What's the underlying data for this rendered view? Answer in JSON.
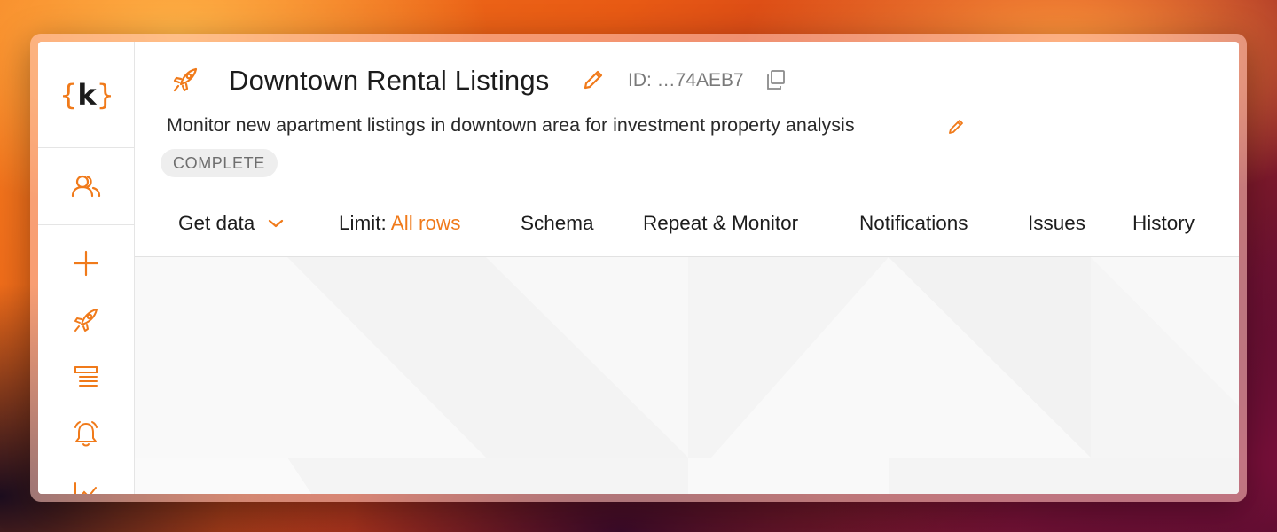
{
  "sidebar": {
    "logo_left": "{",
    "logo_letter": "k",
    "logo_right": "}",
    "items": [
      {
        "icon": "users-icon"
      },
      {
        "icon": "plus-icon"
      },
      {
        "icon": "rocket-icon"
      },
      {
        "icon": "list-icon"
      },
      {
        "icon": "alarm-bell-icon"
      },
      {
        "icon": "chart-icon"
      }
    ]
  },
  "header": {
    "icon": "rocket-icon",
    "title": "Downtown Rental Listings",
    "id_label": "ID: …74AEB7",
    "description": "Monitor new apartment listings in downtown area for investment property analysis",
    "status": "COMPLETE"
  },
  "tabs": {
    "get_data": "Get data",
    "limit_label": "Limit:",
    "limit_value": "All rows",
    "schema": "Schema",
    "repeat_monitor": "Repeat & Monitor",
    "notifications": "Notifications",
    "issues": "Issues",
    "history": "History"
  },
  "colors": {
    "accent": "#f07a1a",
    "text": "#1d1d1d",
    "badge_bg": "#eeeeee"
  }
}
